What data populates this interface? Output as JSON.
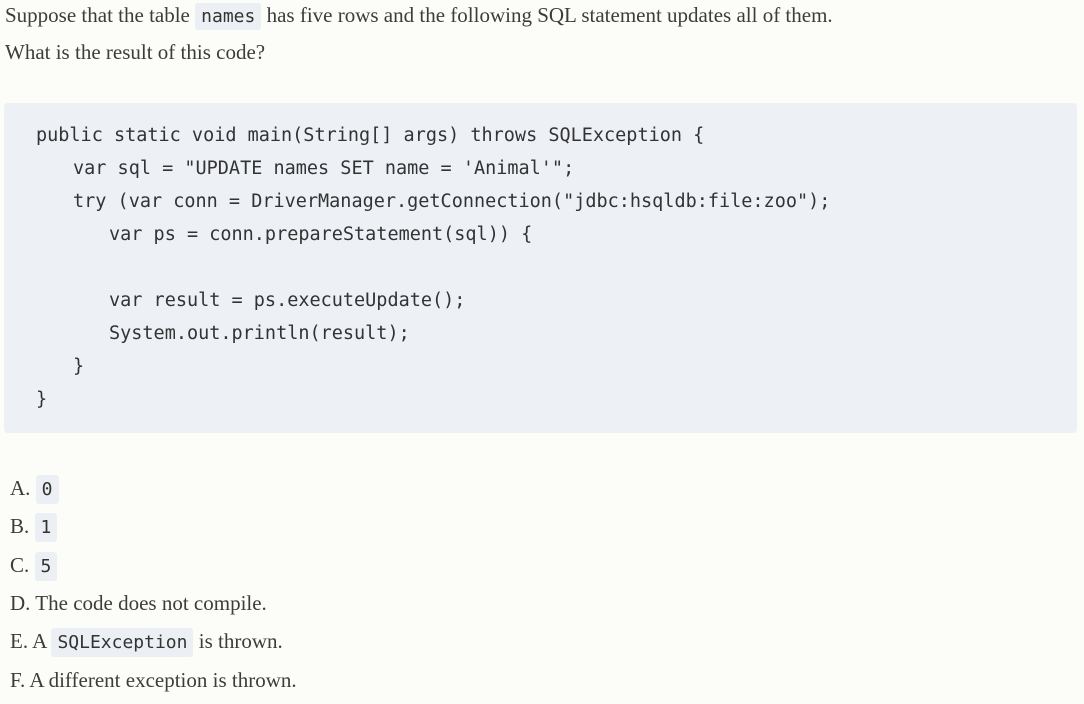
{
  "question": {
    "line1_pre": "Suppose that the table ",
    "line1_code": "names",
    "line1_post": " has five rows and the following SQL statement updates all of them.",
    "line2": "What is the result of this code?"
  },
  "code": {
    "lines": [
      "public static void main(String[] args) throws SQLException {",
      "var sql = \"UPDATE names SET name = 'Animal'\";",
      "try (var conn = DriverManager.getConnection(\"jdbc:hsqldb:file:zoo\");",
      "var ps = conn.prepareStatement(sql)) {",
      "var result = ps.executeUpdate();",
      "System.out.println(result);",
      "}",
      "}"
    ]
  },
  "options": [
    {
      "letter": "A.",
      "code": "0",
      "text": ""
    },
    {
      "letter": "B.",
      "code": "1",
      "text": ""
    },
    {
      "letter": "C.",
      "code": "5",
      "text": ""
    },
    {
      "letter": "D.",
      "pre": "The code does not compile."
    },
    {
      "letter": "E.",
      "pre": "A ",
      "code": "SQLException",
      "post": " is thrown."
    },
    {
      "letter": "F.",
      "pre": "A different exception is thrown."
    }
  ]
}
